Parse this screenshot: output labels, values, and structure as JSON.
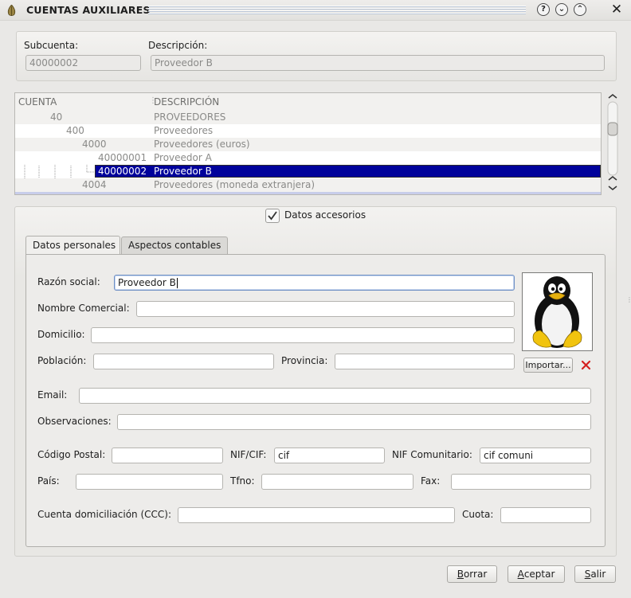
{
  "window": {
    "title": "CUENTAS AUXILIARES"
  },
  "top": {
    "subcuenta_label": "Subcuenta:",
    "subcuenta_value": "40000002",
    "descripcion_label": "Descripción:",
    "descripcion_value": "Proveedor B"
  },
  "tree": {
    "headers": [
      "CUENTA",
      "DESCRIPCIÓN"
    ],
    "rows": [
      {
        "cuenta": "40",
        "descripcion": "PROVEEDORES",
        "level": 0,
        "selected": false
      },
      {
        "cuenta": "400",
        "descripcion": "Proveedores",
        "level": 1,
        "selected": false
      },
      {
        "cuenta": "4000",
        "descripcion": "Proveedores (euros)",
        "level": 2,
        "selected": false
      },
      {
        "cuenta": "40000001",
        "descripcion": "Proveedor A",
        "level": 3,
        "selected": false
      },
      {
        "cuenta": "40000002",
        "descripcion": "Proveedor B",
        "level": 3,
        "selected": true
      },
      {
        "cuenta": "4004",
        "descripcion": "Proveedores (moneda extranjera)",
        "level": 2,
        "selected": false
      }
    ]
  },
  "datos_accesorios": {
    "label": "Datos accesorios",
    "checked": true
  },
  "tabs": [
    {
      "label": "Datos personales",
      "active": true
    },
    {
      "label": "Aspectos contables",
      "active": false
    }
  ],
  "form": {
    "razon_social": {
      "label": "Razón social:",
      "value": "Proveedor B"
    },
    "nombre_comercial": {
      "label": "Nombre Comercial:",
      "value": ""
    },
    "domicilio": {
      "label": "Domicilio:",
      "value": ""
    },
    "poblacion": {
      "label": "Población:",
      "value": ""
    },
    "provincia": {
      "label": "Provincia:",
      "value": ""
    },
    "email": {
      "label": "Email:",
      "value": ""
    },
    "observaciones": {
      "label": "Observaciones:",
      "value": ""
    },
    "codigo_postal": {
      "label": "Código Postal:",
      "value": ""
    },
    "nif_cif": {
      "label": "NIF/CIF:",
      "value": "cif"
    },
    "nif_comunitario": {
      "label": "NIF Comunitario:",
      "value": "cif comuni"
    },
    "pais": {
      "label": "País:",
      "value": ""
    },
    "tfno": {
      "label": "Tfno:",
      "value": ""
    },
    "fax": {
      "label": "Fax:",
      "value": ""
    },
    "cuenta_domiciliacion": {
      "label": "Cuenta domiciliación (CCC):",
      "value": ""
    },
    "cuota": {
      "label": "Cuota:",
      "value": ""
    },
    "importar_label": "Importar..."
  },
  "buttons": {
    "borrar": {
      "first": "B",
      "rest": "orrar"
    },
    "aceptar": {
      "first": "A",
      "rest": "ceptar"
    },
    "salir": {
      "first": "S",
      "rest": "alir"
    }
  },
  "icons": {
    "app": "leaf-icon",
    "help": "question-icon",
    "minimize": "chevron-down-icon",
    "maximize": "chevron-up-icon",
    "close": "close-icon",
    "check": "checkmark-icon",
    "photo": "penguin-icon",
    "delete": "red-x-icon"
  },
  "colors": {
    "selection": "#00029b",
    "accent": "#6d8fc4",
    "delete": "#d42020"
  }
}
